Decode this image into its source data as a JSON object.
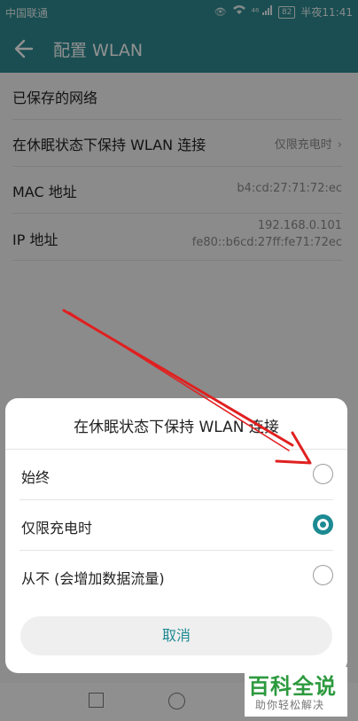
{
  "status_bar": {
    "carrier": "中国联通",
    "signal_label": "⁴⁶",
    "battery": "82",
    "time": "半夜11:41"
  },
  "app_bar": {
    "back_icon": "arrow-back-icon",
    "title": "配置 WLAN"
  },
  "settings": {
    "saved_networks": "已保存的网络",
    "sleep_policy": {
      "label": "在休眠状态下保持 WLAN 连接",
      "value": "仅限充电时"
    },
    "mac": {
      "label": "MAC 地址",
      "value": "b4:cd:27:71:72:ec"
    },
    "ip": {
      "label": "IP 地址",
      "ipv4": "192.168.0.101",
      "ipv6": "fe80::b6cd:27ff:fe71:72ec"
    }
  },
  "dialog": {
    "title": "在休眠状态下保持 WLAN 连接",
    "options": [
      {
        "label": "始终",
        "selected": false
      },
      {
        "label": "仅限充电时",
        "selected": true
      },
      {
        "label": "从不 (会增加数据流量)",
        "selected": false
      }
    ],
    "cancel_label": "取消"
  },
  "watermark": {
    "brand": "百科全说",
    "tagline": "助你轻松解决"
  },
  "colors": {
    "accent": "#1c8a93",
    "header": "#2e8a90",
    "annotation_arrow": "#e02020",
    "watermark_green": "#2d9a3f"
  }
}
